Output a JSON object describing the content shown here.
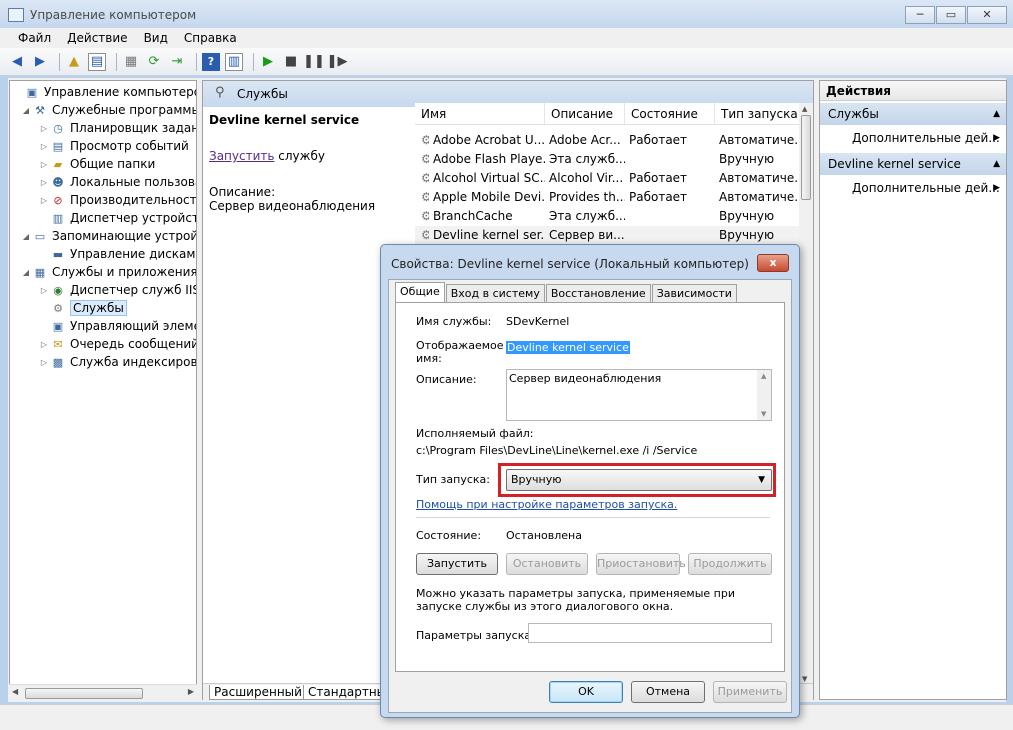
{
  "window": {
    "title": "Управление компьютером"
  },
  "menu": [
    "Файл",
    "Действие",
    "Вид",
    "Справка"
  ],
  "tree": [
    {
      "label": "Управление компьютером (л",
      "level": 0,
      "expander": ""
    },
    {
      "label": "Служебные программы",
      "level": 1,
      "expander": "◢"
    },
    {
      "label": "Планировщик заданий",
      "level": 2,
      "expander": "▷"
    },
    {
      "label": "Просмотр событий",
      "level": 2,
      "expander": "▷"
    },
    {
      "label": "Общие папки",
      "level": 2,
      "expander": "▷"
    },
    {
      "label": "Локальные пользовате",
      "level": 2,
      "expander": "▷"
    },
    {
      "label": "Производительность",
      "level": 2,
      "expander": "▷"
    },
    {
      "label": "Диспетчер устройств",
      "level": 2,
      "expander": ""
    },
    {
      "label": "Запоминающие устройст",
      "level": 1,
      "expander": "◢"
    },
    {
      "label": "Управление дисками",
      "level": 2,
      "expander": ""
    },
    {
      "label": "Службы и приложения",
      "level": 1,
      "expander": "◢"
    },
    {
      "label": "Диспетчер служб IIS",
      "level": 2,
      "expander": "▷"
    },
    {
      "label": "Службы",
      "level": 2,
      "expander": "",
      "selected": true
    },
    {
      "label": "Управляющий элемен",
      "level": 2,
      "expander": ""
    },
    {
      "label": "Очередь сообщений",
      "level": 2,
      "expander": "▷"
    },
    {
      "label": "Служба индексирован",
      "level": 2,
      "expander": "▷"
    }
  ],
  "services_panel": {
    "header": "Службы",
    "selected_name": "Devline kernel service",
    "start_link": "Запустить",
    "start_link_suffix": " службу",
    "desc_label": "Описание:",
    "desc_text": "Сервер видеонаблюдения",
    "columns": [
      "Имя",
      "Описание",
      "Состояние",
      "Тип запуска"
    ],
    "rows": [
      [
        "Adobe Acrobat U...",
        "Adobe Acr...",
        "Работает",
        "Автоматиче..."
      ],
      [
        "Adobe Flash Playe...",
        "Эта служб...",
        "",
        "Вручную"
      ],
      [
        "Alcohol Virtual SC...",
        "Alcohol Vir...",
        "Работает",
        "Автоматиче..."
      ],
      [
        "Apple Mobile Devi...",
        "Provides th...",
        "Работает",
        "Автоматиче..."
      ],
      [
        "BranchCache",
        "Эта служб...",
        "",
        "Вручную"
      ],
      [
        "Devline kernel ser...",
        "Сервер ви...",
        "",
        "Вручную"
      ]
    ],
    "tabs": [
      "Расширенный",
      "Стандартный"
    ]
  },
  "actions": {
    "header": "Действия",
    "groups": [
      {
        "title": "Службы",
        "item": "Дополнительные дей..."
      },
      {
        "title": "Devline kernel service",
        "item": "Дополнительные дей..."
      }
    ]
  },
  "dialog": {
    "title": "Свойства: Devline kernel service (Локальный компьютер)",
    "close": "x",
    "tabs": [
      "Общие",
      "Вход в систему",
      "Восстановление",
      "Зависимости"
    ],
    "service_name_label": "Имя службы:",
    "service_name": "SDevKernel",
    "display_name_label": "Отображаемое имя:",
    "display_name": "Devline kernel service",
    "description_label": "Описание:",
    "description": "Сервер видеонаблюдения",
    "exe_label": "Исполняемый файл:",
    "exe_path": "c:\\Program Files\\DevLine\\Line\\kernel.exe /i /Service",
    "startup_label": "Тип запуска:",
    "startup_value": "Вручную",
    "help_link": "Помощь при настройке параметров запуска.",
    "state_label": "Состояние:",
    "state_value": "Остановлена",
    "btn_start": "Запустить",
    "btn_stop": "Остановить",
    "btn_pause": "Приостановить",
    "btn_continue": "Продолжить",
    "hint": "Можно указать параметры запуска, применяемые при запуске службы из этого диалогового окна.",
    "params_label": "Параметры запуска:",
    "params_value": "",
    "ok": "OK",
    "cancel": "Отмена",
    "apply": "Применить"
  }
}
